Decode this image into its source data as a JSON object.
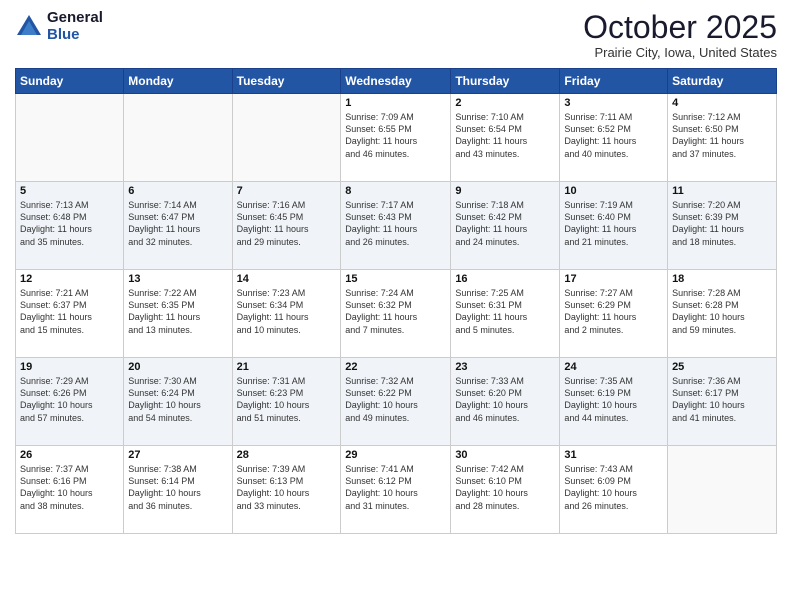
{
  "header": {
    "logo_general": "General",
    "logo_blue": "Blue",
    "month_title": "October 2025",
    "location": "Prairie City, Iowa, United States"
  },
  "days_of_week": [
    "Sunday",
    "Monday",
    "Tuesday",
    "Wednesday",
    "Thursday",
    "Friday",
    "Saturday"
  ],
  "weeks": [
    [
      {
        "num": "",
        "info": ""
      },
      {
        "num": "",
        "info": ""
      },
      {
        "num": "",
        "info": ""
      },
      {
        "num": "1",
        "info": "Sunrise: 7:09 AM\nSunset: 6:55 PM\nDaylight: 11 hours\nand 46 minutes."
      },
      {
        "num": "2",
        "info": "Sunrise: 7:10 AM\nSunset: 6:54 PM\nDaylight: 11 hours\nand 43 minutes."
      },
      {
        "num": "3",
        "info": "Sunrise: 7:11 AM\nSunset: 6:52 PM\nDaylight: 11 hours\nand 40 minutes."
      },
      {
        "num": "4",
        "info": "Sunrise: 7:12 AM\nSunset: 6:50 PM\nDaylight: 11 hours\nand 37 minutes."
      }
    ],
    [
      {
        "num": "5",
        "info": "Sunrise: 7:13 AM\nSunset: 6:48 PM\nDaylight: 11 hours\nand 35 minutes."
      },
      {
        "num": "6",
        "info": "Sunrise: 7:14 AM\nSunset: 6:47 PM\nDaylight: 11 hours\nand 32 minutes."
      },
      {
        "num": "7",
        "info": "Sunrise: 7:16 AM\nSunset: 6:45 PM\nDaylight: 11 hours\nand 29 minutes."
      },
      {
        "num": "8",
        "info": "Sunrise: 7:17 AM\nSunset: 6:43 PM\nDaylight: 11 hours\nand 26 minutes."
      },
      {
        "num": "9",
        "info": "Sunrise: 7:18 AM\nSunset: 6:42 PM\nDaylight: 11 hours\nand 24 minutes."
      },
      {
        "num": "10",
        "info": "Sunrise: 7:19 AM\nSunset: 6:40 PM\nDaylight: 11 hours\nand 21 minutes."
      },
      {
        "num": "11",
        "info": "Sunrise: 7:20 AM\nSunset: 6:39 PM\nDaylight: 11 hours\nand 18 minutes."
      }
    ],
    [
      {
        "num": "12",
        "info": "Sunrise: 7:21 AM\nSunset: 6:37 PM\nDaylight: 11 hours\nand 15 minutes."
      },
      {
        "num": "13",
        "info": "Sunrise: 7:22 AM\nSunset: 6:35 PM\nDaylight: 11 hours\nand 13 minutes."
      },
      {
        "num": "14",
        "info": "Sunrise: 7:23 AM\nSunset: 6:34 PM\nDaylight: 11 hours\nand 10 minutes."
      },
      {
        "num": "15",
        "info": "Sunrise: 7:24 AM\nSunset: 6:32 PM\nDaylight: 11 hours\nand 7 minutes."
      },
      {
        "num": "16",
        "info": "Sunrise: 7:25 AM\nSunset: 6:31 PM\nDaylight: 11 hours\nand 5 minutes."
      },
      {
        "num": "17",
        "info": "Sunrise: 7:27 AM\nSunset: 6:29 PM\nDaylight: 11 hours\nand 2 minutes."
      },
      {
        "num": "18",
        "info": "Sunrise: 7:28 AM\nSunset: 6:28 PM\nDaylight: 10 hours\nand 59 minutes."
      }
    ],
    [
      {
        "num": "19",
        "info": "Sunrise: 7:29 AM\nSunset: 6:26 PM\nDaylight: 10 hours\nand 57 minutes."
      },
      {
        "num": "20",
        "info": "Sunrise: 7:30 AM\nSunset: 6:24 PM\nDaylight: 10 hours\nand 54 minutes."
      },
      {
        "num": "21",
        "info": "Sunrise: 7:31 AM\nSunset: 6:23 PM\nDaylight: 10 hours\nand 51 minutes."
      },
      {
        "num": "22",
        "info": "Sunrise: 7:32 AM\nSunset: 6:22 PM\nDaylight: 10 hours\nand 49 minutes."
      },
      {
        "num": "23",
        "info": "Sunrise: 7:33 AM\nSunset: 6:20 PM\nDaylight: 10 hours\nand 46 minutes."
      },
      {
        "num": "24",
        "info": "Sunrise: 7:35 AM\nSunset: 6:19 PM\nDaylight: 10 hours\nand 44 minutes."
      },
      {
        "num": "25",
        "info": "Sunrise: 7:36 AM\nSunset: 6:17 PM\nDaylight: 10 hours\nand 41 minutes."
      }
    ],
    [
      {
        "num": "26",
        "info": "Sunrise: 7:37 AM\nSunset: 6:16 PM\nDaylight: 10 hours\nand 38 minutes."
      },
      {
        "num": "27",
        "info": "Sunrise: 7:38 AM\nSunset: 6:14 PM\nDaylight: 10 hours\nand 36 minutes."
      },
      {
        "num": "28",
        "info": "Sunrise: 7:39 AM\nSunset: 6:13 PM\nDaylight: 10 hours\nand 33 minutes."
      },
      {
        "num": "29",
        "info": "Sunrise: 7:41 AM\nSunset: 6:12 PM\nDaylight: 10 hours\nand 31 minutes."
      },
      {
        "num": "30",
        "info": "Sunrise: 7:42 AM\nSunset: 6:10 PM\nDaylight: 10 hours\nand 28 minutes."
      },
      {
        "num": "31",
        "info": "Sunrise: 7:43 AM\nSunset: 6:09 PM\nDaylight: 10 hours\nand 26 minutes."
      },
      {
        "num": "",
        "info": ""
      }
    ]
  ]
}
